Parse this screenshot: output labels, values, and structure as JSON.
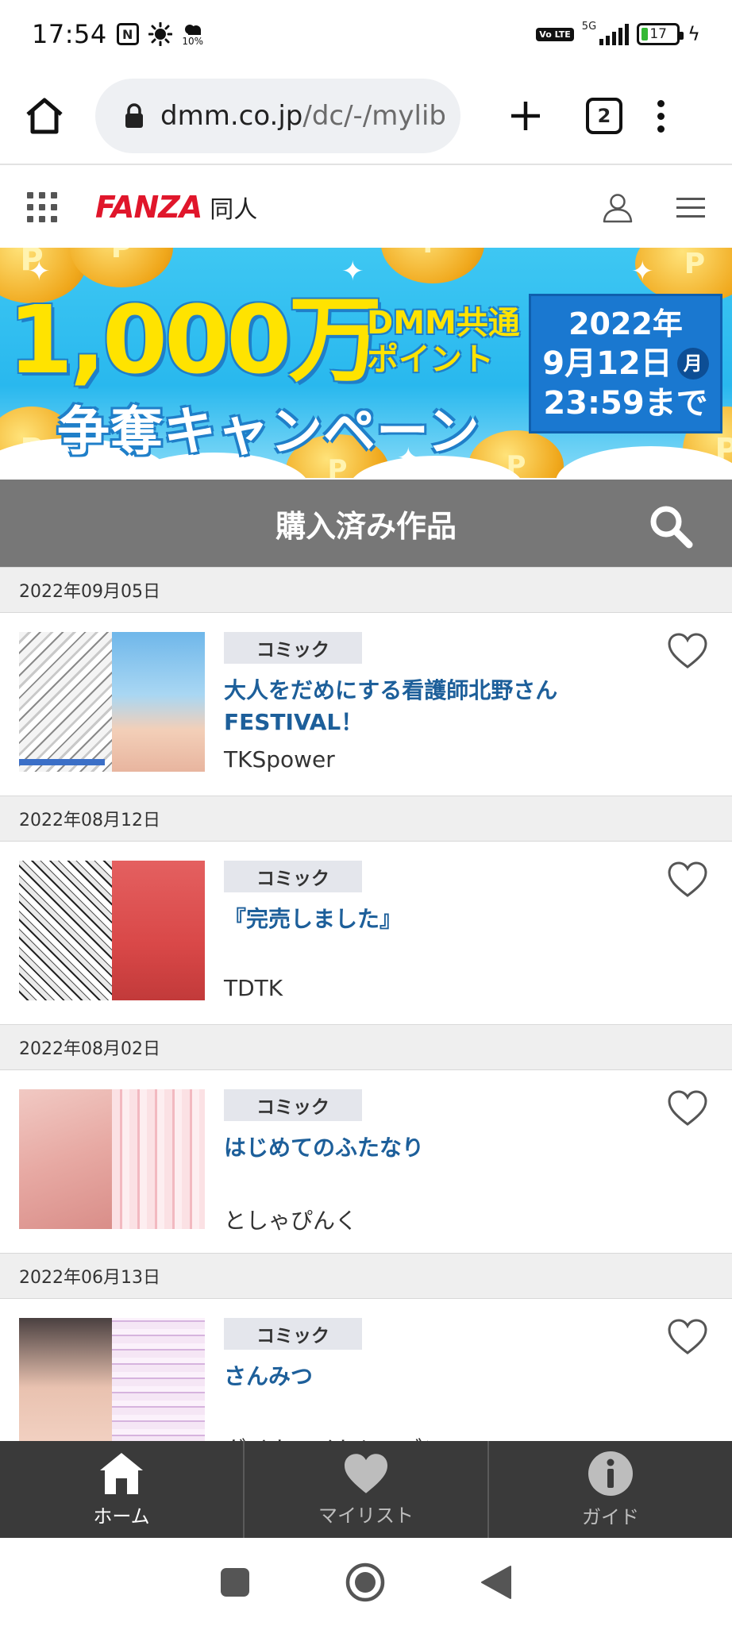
{
  "status_bar": {
    "time": "17:54",
    "nfc_label": "N",
    "weather_percent": "10%",
    "volte": "Vo LTE",
    "network": "5G",
    "battery": "17"
  },
  "browser": {
    "url_host": "dmm.co.jp",
    "url_path": "/dc/-/mylib",
    "tab_count": "2"
  },
  "site_header": {
    "logo_brand": "FANZA",
    "logo_sub": "同人"
  },
  "banner": {
    "amount": "1,000万",
    "points_line1": "DMM共通",
    "points_line2": "ポイント",
    "campaign": "争奪キャンペーン",
    "date_year": "2022年",
    "date_day": "9月12日",
    "date_weekday": "月",
    "date_deadline": "23:59まで"
  },
  "page_title": "購入済み作品",
  "items": [
    {
      "date": "2022年09月05日",
      "genre": "コミック",
      "title": "大人をだめにする看護師北野さんFESTIVAL！",
      "author": "TKSpower"
    },
    {
      "date": "2022年08月12日",
      "genre": "コミック",
      "title": "『完売しました』",
      "author": "TDTK"
    },
    {
      "date": "2022年08月02日",
      "genre": "コミック",
      "title": "はじめてのふたなり",
      "author": "としゃぴんく"
    },
    {
      "date": "2022年06月13日",
      "genre": "コミック",
      "title": "さんみつ",
      "author": "ダイナマイトシーズン"
    }
  ],
  "bottom_nav": [
    {
      "label": "ホーム",
      "icon": "home-icon",
      "active": true
    },
    {
      "label": "マイリスト",
      "icon": "heart-icon",
      "active": false
    },
    {
      "label": "ガイド",
      "icon": "info-icon",
      "active": false
    }
  ],
  "colors": {
    "brand_red": "#e0162b",
    "title_bar": "#777777",
    "link_blue": "#1d5f9a",
    "bottom_nav": "#3a3a3a"
  }
}
